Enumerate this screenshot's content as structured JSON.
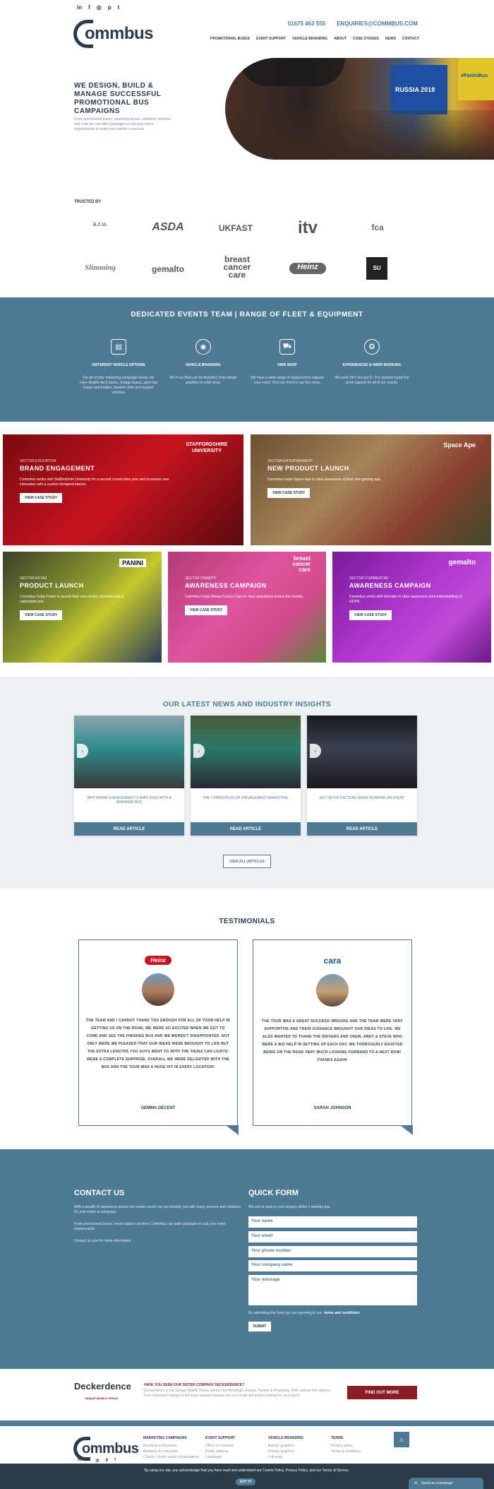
{
  "header": {
    "social_icons": [
      "linkedin-icon",
      "facebook-icon",
      "instagram-icon",
      "pinterest-icon",
      "twitter-icon"
    ],
    "social_glyphs": [
      "in",
      "f",
      "◎",
      "p",
      "t"
    ],
    "phone": "01675 463 555",
    "email": "ENQUIRIES@COMMBUS.COM",
    "logo_text": "ommbus",
    "nav": [
      "PROMOTIONAL BUSES",
      "EVENT SUPPORT",
      "VEHICLE BRANDING",
      "ABOUT",
      "CASE STUDIES",
      "NEWS",
      "CONTACT"
    ]
  },
  "hero": {
    "title": "WE DESIGN, BUILD & MANAGE SUCCESSFUL PROMOTIONAL BUS CAMPAIGNS",
    "subtitle": "From promotional buses, roadshow buses, exhibition vehicles and crew we can tailor packages to suit your event requirements to make your events a success.",
    "image_badge": "#PaniniBus",
    "image_sign": "RUSSIA 2018"
  },
  "trusted": {
    "label": "TRUSTED BY",
    "row1": [
      "a.r.u.",
      "ASDA",
      "UKFAST",
      "itv",
      "fca"
    ],
    "row2": [
      "Slimming",
      "gemalto",
      "breast cancer care",
      "Heinz",
      "SU"
    ]
  },
  "team": {
    "title": "DEDICATED EVENTS TEAM  |  RANGE OF FLEET & EQUIPMENT",
    "features": [
      {
        "icon": "bus-icon",
        "glyph": "▤",
        "title": "DIFFERENT VEHICLE OPTIONS",
        "desc": "For all of your marketing campaign needs, we have double deck buses, vintage buses, open top buses and trailers, towable units and support vehicles."
      },
      {
        "icon": "eye-icon",
        "glyph": "◉",
        "title": "VEHICLE BRANDING",
        "desc": "All of our fleet can be branded, from simple graphics to a full wrap."
      },
      {
        "icon": "cart-icon",
        "glyph": "⛟",
        "title": "HIRE SHOP",
        "desc": "We have a wide range of equipment to support your event. Find our more in our hire shop."
      },
      {
        "icon": "badge-icon",
        "glyph": "✪",
        "title": "EXPERIENCED & HARD WORKING",
        "desc": "We work 24/7 not just 9 - 5 to provide round the clock support for all of our events."
      }
    ]
  },
  "cases": [
    {
      "sector": "SECTOR:EDUCATION",
      "title": "BRAND ENGAGEMENT",
      "text": "Commbus works with Staffordshire University for a second consecutive year and increases user interaction with a custom designed interior.",
      "button": "VIEW CASE STUDY",
      "brand": "STAFFORDSHIRE UNIVERSITY",
      "bg": "#b3121b"
    },
    {
      "sector": "SECTOR:ENTERTAINMENT",
      "title": "NEW PRODUCT LAUNCH",
      "text": "Commbus helps Space Ape to raise awareness of their new gaming app.",
      "button": "VIEW CASE STUDY",
      "brand": "Space Ape",
      "bg": "#8a6a48"
    },
    {
      "sector": "SECTOR:RETAIL",
      "title": "PRODUCT LAUNCH",
      "text": "Commbus helps Panini to launch their new sticker collection with a nationwide tour.",
      "button": "VIEW CASE STUDY",
      "brand": "PANINI",
      "bg": "#6c7a2a"
    },
    {
      "sector": "SECTOR:CHARITY",
      "title": "AWARENESS CAMPAIGN",
      "text": "Commbus helps Breast Cancer Care to raise awareness across the country.",
      "button": "VIEW CASE STUDY",
      "brand": "breast cancer care",
      "bg": "#c24a8c"
    },
    {
      "sector": "SECTOR:COMMERCIAL",
      "title": "AWARENESS CAMPAIGN",
      "text": "Commbus works with Gemalto to raise awareness and understanding of GDPR.",
      "button": "VIEW CASE STUDY",
      "brand": "gemalto",
      "bg": "#9b2fb3"
    }
  ],
  "news": {
    "title": "OUR LATEST NEWS AND INDUSTRY INSIGHTS",
    "articles": [
      {
        "caption": "WHY BRAND ENGAGEMENT IS AMPLIFIED WITH A BRANDED BUS",
        "button": "READ ARTICLE"
      },
      {
        "caption": "THE 7 PRINCIPLES OF ENGAGEMENT MARKETING",
        "button": "READ ARTICLE"
      },
      {
        "caption": "KEY SETUP FACTORS WHEN RUNNING AN EVENT",
        "button": "READ ARTICLE"
      }
    ],
    "view_all": "VIEW ALL ARTICLES"
  },
  "testimonials": {
    "title": "TESTIMONIALS",
    "items": [
      {
        "logo": "Heinz",
        "quote": "THE TEAM AND I CANNOT THANK YOU ENOUGH FOR ALL OF YOUR HELP IN GETTING US ON THE ROAD. WE WERE SO EXCITED WHEN WE GOT TO COME AND SEE THE FINISHED BUS AND WE WEREN'T DISAPPOINTED. NOT ONLY WERE WE PLEASED THAT OUR IDEAS WERE BROUGHT TO LIFE BUT THE EXTRA LENGTHS YOU GUYS WENT TO WITH THE 'HEINZ CAN LIGHTS' WERE A COMPLETE SURPRISE. OVERALL WE WERE DELIGHTED WITH THE BUS AND THE TOUR WAS A HUGE HIT IN EVERY LOCATION!",
        "name": "GEMMA DECENT"
      },
      {
        "logo": "cara",
        "quote": "THE TOUR WAS A GREAT SUCCESS! BROOKE AND THE TEAM WERE VERY SUPPORTIVE AND THEIR GUIDANCE BROUGHT OUR IDEAS TO LIFE. WE ALSO WANTED TO THANK THE DRIVERS AND CREW, ANDY & STEVE WHO WERE A BIG HELP IN SETTING UP EACH DAY. WE THOROUGHLY ENJOYED BEING ON THE ROAD VERY MUCH LOOKING FORWARD TO A NEXT ROW! THANKS AGAIN!",
        "name": "SARAH JOHNSON"
      }
    ]
  },
  "contact": {
    "title": "CONTACT US",
    "p1": "With a wealth of experience across the events sector we can provide you with many services and solutions for your event or campaign.",
    "p2": "From promotional buses, event support services Commbus can tailor packages to suit your event requirements.",
    "p3": "Contact us now for more information."
  },
  "form": {
    "title": "QUICK FORM",
    "intro": "We aim to reply to your enquiry within 1 working day.",
    "name": "Your name",
    "email": "Your email",
    "phone": "Your phone number",
    "company": "Your company name",
    "message": "Your message",
    "terms_prefix": "By submitting this form you are agreeing to our",
    "terms_link": "terms and conditions",
    "submit": "SUBMIT"
  },
  "sister": {
    "logo": "Deckerdence",
    "logo_sub": "UNIQUE MOBILE VENUE",
    "heading": "HAVE YOU SEEN OUR SISTER COMPANY DECKERDENCE?",
    "text": "Deckerdence is our Unique Mobile Venue, perfect for Weddings, Events, Parties & Hospitality. With various hire options from unbooked canopy to full wrap around marquee we can create the perfect setting for your event.",
    "button": "FIND OUT MORE"
  },
  "footer": {
    "cols": [
      {
        "h": "MARKETING CAMPAIGNS",
        "items": [
          "Business to Business",
          "Business to consumer",
          "Charity / public sector organisations"
        ]
      },
      {
        "h": "EVENT SUPPORT",
        "items": [
          "Office on Location",
          "Public address",
          "Landstage"
        ]
      },
      {
        "h": "VEHICLE BRANDING",
        "items": [
          "Banner graphics",
          "Display graphics",
          "Full wrap"
        ]
      },
      {
        "h": "TERMS",
        "items": [
          "Privacy policy",
          "Terms & conditions"
        ]
      }
    ]
  },
  "cookie": {
    "text": "By using our site, you acknowledge that you have read and understand our Cookie Policy, Privacy Policy, and our Terms of Service.",
    "button": "GOT IT"
  },
  "chat": {
    "label": "Send us a message"
  }
}
